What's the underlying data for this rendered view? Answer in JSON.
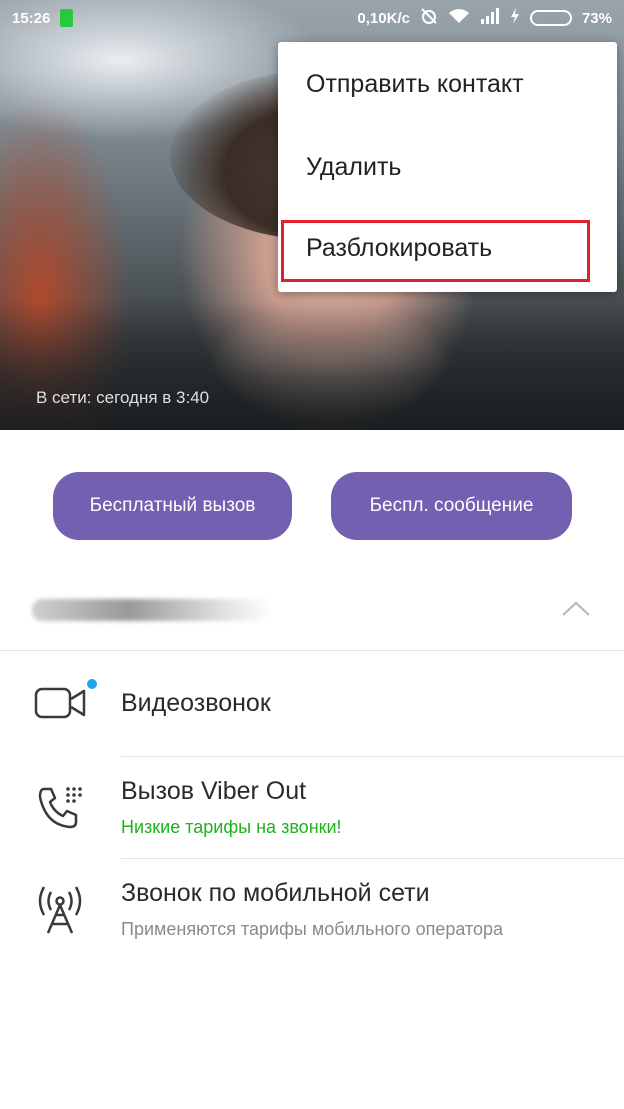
{
  "status_bar": {
    "time": "15:26",
    "speed": "0,10K/c",
    "battery_percent": "73%",
    "battery_level": 0.73,
    "accent_color": "#28c840"
  },
  "photo": {
    "last_seen": "В сети: сегодня в 3:40"
  },
  "menu": {
    "items": [
      {
        "label": "Отправить контакт"
      },
      {
        "label": "Удалить"
      },
      {
        "label": "Разблокировать"
      }
    ],
    "highlight_color": "#e0202a"
  },
  "actions": {
    "free_call_label": "Бесплатный вызов",
    "free_message_label": "Беспл. сообщение",
    "button_color": "#7360b1"
  },
  "options": [
    {
      "title": "Видеозвонок",
      "icon": "video-camera-icon"
    },
    {
      "title": "Вызов Viber Out",
      "subtitle": "Низкие тарифы на звонки!",
      "subtitle_color": "#1db31d",
      "icon": "phone-keypad-icon"
    },
    {
      "title": "Звонок по мобильной сети",
      "subtitle": "Применяются тарифы мобильного оператора",
      "subtitle_color": "#8a8a8a",
      "icon": "cell-tower-icon"
    }
  ]
}
